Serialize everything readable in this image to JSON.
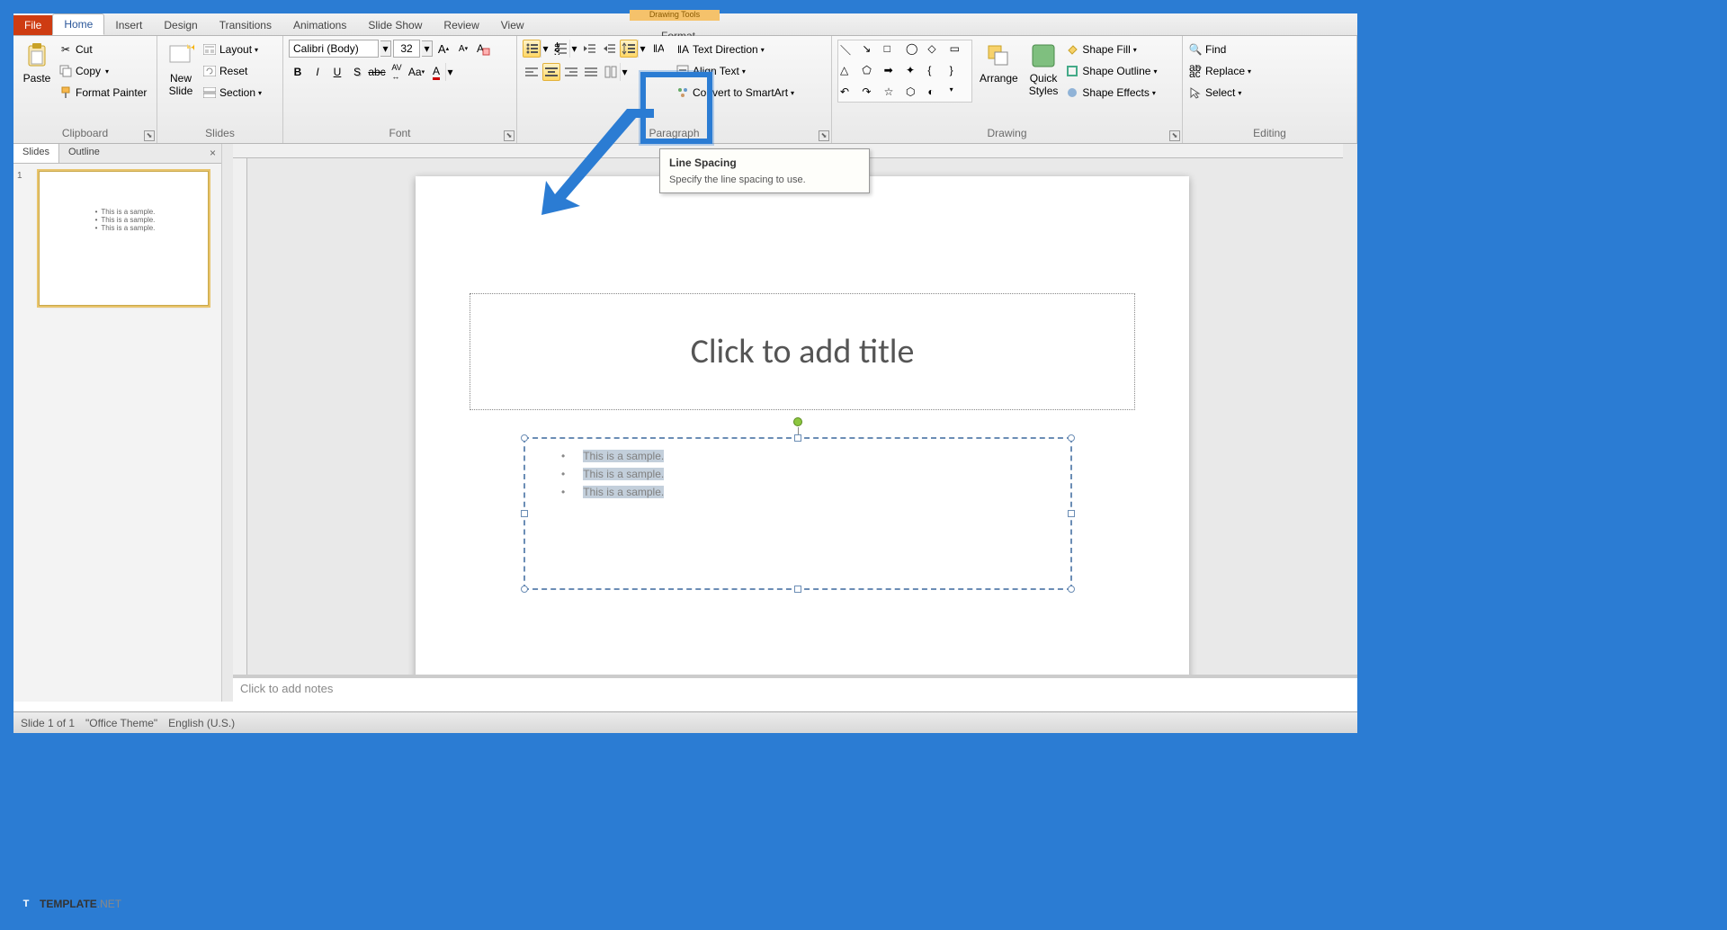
{
  "tabs": {
    "file": "File",
    "home": "Home",
    "insert": "Insert",
    "design": "Design",
    "transitions": "Transitions",
    "animations": "Animations",
    "slideshow": "Slide Show",
    "review": "Review",
    "view": "View",
    "format": "Format",
    "contextual": "Drawing Tools"
  },
  "clipboard": {
    "title": "Clipboard",
    "paste": "Paste",
    "cut": "Cut",
    "copy": "Copy",
    "fmt": "Format Painter"
  },
  "slides": {
    "title": "Slides",
    "new": "New\nSlide",
    "layout": "Layout",
    "reset": "Reset",
    "section": "Section"
  },
  "font": {
    "title": "Font",
    "name": "Calibri (Body)",
    "size": "32"
  },
  "paragraph": {
    "title": "Paragraph",
    "textdir": "Text Direction",
    "align": "Align Text",
    "smartart": "Convert to SmartArt"
  },
  "drawing": {
    "title": "Drawing",
    "arrange": "Arrange",
    "quick": "Quick\nStyles",
    "fill": "Shape Fill",
    "outline": "Shape Outline",
    "effects": "Shape Effects"
  },
  "editing": {
    "title": "Editing",
    "find": "Find",
    "replace": "Replace",
    "select": "Select"
  },
  "leftpanel": {
    "slides": "Slides",
    "outline": "Outline",
    "close": "×"
  },
  "thumb": {
    "l1": "This is a sample.",
    "l2": "This is a sample.",
    "l3": "This is a sample."
  },
  "slide": {
    "title": "Click to add title",
    "b1": "This is a sample.",
    "b2": "This is a sample.",
    "b3": "This is a sample."
  },
  "tooltip": {
    "title": "Line Spacing",
    "body": "Specify the line spacing to use."
  },
  "notes": "Click to add notes",
  "status": {
    "slide": "Slide 1 of 1",
    "theme": "\"Office Theme\"",
    "lang": "English (U.S.)"
  },
  "watermark": {
    "main": "TEMPLATE",
    "ext": ".NET"
  }
}
